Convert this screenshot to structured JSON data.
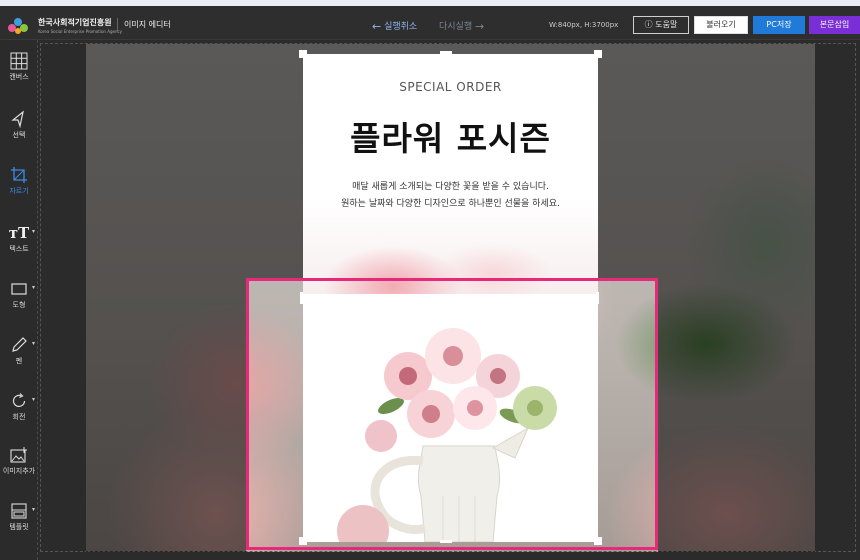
{
  "header": {
    "org_name": "한국사회적기업진흥원",
    "org_subtitle": "Korea Social Enterprise Promotion Agency",
    "app_name": "이미지 에디터",
    "undo_label": "실행취소",
    "redo_label": "다시실행",
    "canvas_size": "W:840px, H:3700px",
    "help_label": "도움말",
    "load_label": "불러오기",
    "save_label": "PC저장",
    "insert_label": "본문삽입",
    "colors": {
      "save": "#1f7ad8",
      "insert": "#7a2fd6",
      "undo": "#8fb4f2",
      "crop_frame": "#e8287a"
    }
  },
  "toolbar": [
    {
      "id": "canvas",
      "label": "캔버스",
      "icon": "grid-icon",
      "has_menu": false,
      "active": false
    },
    {
      "id": "select",
      "label": "선택",
      "icon": "cursor-icon",
      "has_menu": false,
      "active": false
    },
    {
      "id": "crop",
      "label": "자르기",
      "icon": "crop-icon",
      "has_menu": false,
      "active": true
    },
    {
      "id": "text",
      "label": "텍스트",
      "icon": "text-icon",
      "has_menu": true,
      "active": false
    },
    {
      "id": "shape",
      "label": "도형",
      "icon": "rectangle-icon",
      "has_menu": true,
      "active": false
    },
    {
      "id": "pen",
      "label": "펜",
      "icon": "pen-icon",
      "has_menu": true,
      "active": false
    },
    {
      "id": "rotate",
      "label": "회전",
      "icon": "rotate-icon",
      "has_menu": true,
      "active": false
    },
    {
      "id": "add_image",
      "label": "이미지추가",
      "icon": "image-add-icon",
      "has_menu": false,
      "active": false
    },
    {
      "id": "template",
      "label": "템플릿",
      "icon": "template-icon",
      "has_menu": true,
      "active": false
    }
  ],
  "canvas": {
    "special_order": "SPECIAL ORDER",
    "headline": "플라워 포시즌",
    "desc_line1": "매달 새롭게 소개되는 다양한 꽃을 받을 수 있습니다.",
    "desc_line2": "원하는 날짜와 다양한 디자인으로 하나뿐인 선물을 하세요."
  }
}
